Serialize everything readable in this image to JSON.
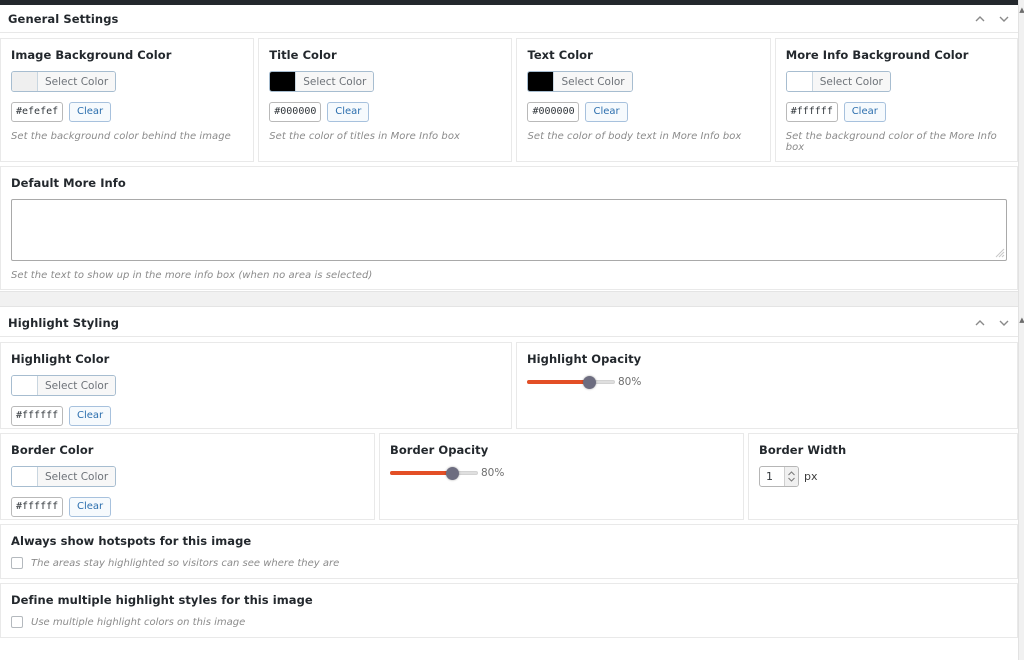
{
  "sections": [
    {
      "title": "General Settings",
      "tools": {
        "collapse_icon": "chevron-up-icon",
        "expand_icon": "chevron-down-icon"
      }
    },
    {
      "title": "Highlight Styling",
      "tools": {
        "collapse_icon": "chevron-up-icon",
        "expand_icon": "chevron-down-icon"
      }
    }
  ],
  "general": {
    "color_fields": [
      {
        "label": "Image Background Color",
        "swatch": "#efefef",
        "select_label": "Select Color",
        "hex_value": "#efefef",
        "clear_label": "Clear",
        "helper": "Set the background color behind the image"
      },
      {
        "label": "Title Color",
        "swatch": "#000000",
        "select_label": "Select Color",
        "hex_value": "#000000",
        "clear_label": "Clear",
        "helper": "Set the color of titles in More Info box"
      },
      {
        "label": "Text Color",
        "swatch": "#000000",
        "select_label": "Select Color",
        "hex_value": "#000000",
        "clear_label": "Clear",
        "helper": "Set the color of body text in More Info box"
      },
      {
        "label": "More Info Background Color",
        "swatch": "#ffffff",
        "select_label": "Select Color",
        "hex_value": "#ffffff",
        "clear_label": "Clear",
        "helper": "Set the background color of the More Info box"
      }
    ],
    "default_more_info": {
      "label": "Default More Info",
      "value": "",
      "helper": "Set the text to show up in the more info box (when no area is selected)"
    }
  },
  "highlight": {
    "highlight_color": {
      "label": "Highlight Color",
      "swatch": "#ffffff",
      "select_label": "Select Color",
      "hex_value": "#ffffff",
      "clear_label": "Clear"
    },
    "highlight_opacity": {
      "label": "Highlight Opacity",
      "value": 80,
      "display": "80%",
      "min": 0,
      "max": 100,
      "fill_color": "#e34f26",
      "thumb_color": "#6d6d80"
    },
    "border_color": {
      "label": "Border Color",
      "swatch": "#ffffff",
      "select_label": "Select Color",
      "hex_value": "#ffffff",
      "clear_label": "Clear"
    },
    "border_opacity": {
      "label": "Border Opacity",
      "value": 80,
      "display": "80%",
      "min": 0,
      "max": 100,
      "fill_color": "#e34f26",
      "thumb_color": "#6d6d80"
    },
    "border_width": {
      "label": "Border Width",
      "value": "1",
      "unit": "px"
    },
    "always_show": {
      "label": "Always show hotspots for this image",
      "checked": false,
      "description": "The areas stay highlighted so visitors can see where they are"
    },
    "multi_styles": {
      "label": "Define multiple highlight styles for this image",
      "checked": false,
      "description": "Use multiple highlight colors on this image"
    }
  },
  "scrollbar": {
    "up_arrow": "scroll-up-arrow-icon"
  }
}
